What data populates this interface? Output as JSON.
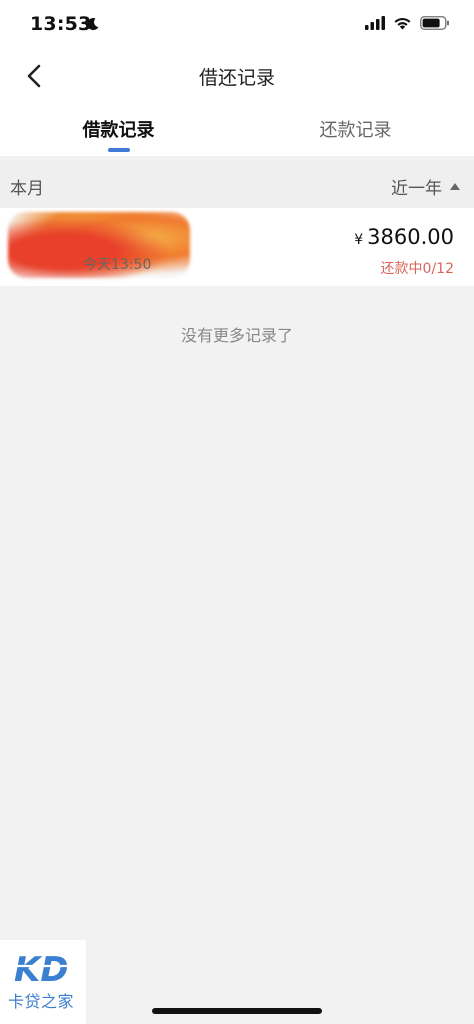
{
  "status_bar": {
    "time": "13:53",
    "icons": [
      "moon-icon",
      "signal-icon",
      "wifi-icon",
      "battery-icon"
    ]
  },
  "nav": {
    "title": "借还记录",
    "back_icon": "chevron-left-icon"
  },
  "tabs": [
    {
      "label": "借款记录",
      "active": true
    },
    {
      "label": "还款记录",
      "active": false
    }
  ],
  "filter": {
    "month_label": "本月",
    "range_label": "近一年",
    "range_icon": "triangle-up-icon"
  },
  "records": [
    {
      "time": "今天13:50",
      "currency": "¥",
      "amount": "3860.00",
      "status": "还款中0/12"
    }
  ],
  "no_more_text": "没有更多记录了",
  "watermark": {
    "logo": "KD",
    "text": "卡贷之家"
  },
  "colors": {
    "accent": "#3f7bd6",
    "status_red": "#d9655a",
    "background": "#f2f2f2"
  }
}
